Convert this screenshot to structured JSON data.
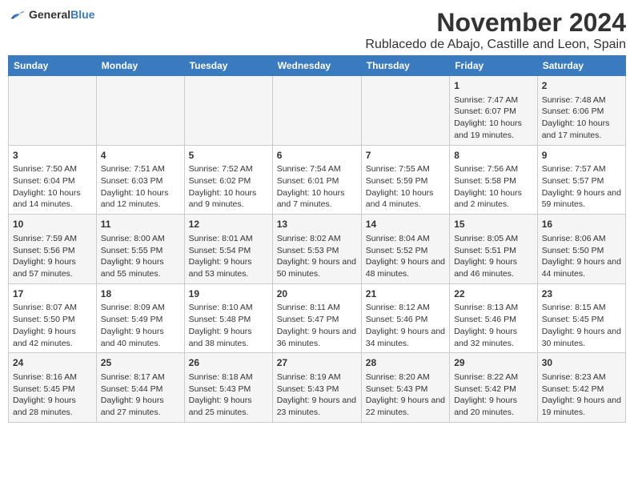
{
  "logo": {
    "general": "General",
    "blue": "Blue"
  },
  "title": "November 2024",
  "subtitle": "Rublacedo de Abajo, Castille and Leon, Spain",
  "days_header": [
    "Sunday",
    "Monday",
    "Tuesday",
    "Wednesday",
    "Thursday",
    "Friday",
    "Saturday"
  ],
  "weeks": [
    [
      {
        "day": "",
        "info": ""
      },
      {
        "day": "",
        "info": ""
      },
      {
        "day": "",
        "info": ""
      },
      {
        "day": "",
        "info": ""
      },
      {
        "day": "",
        "info": ""
      },
      {
        "day": "1",
        "info": "Sunrise: 7:47 AM\nSunset: 6:07 PM\nDaylight: 10 hours and 19 minutes."
      },
      {
        "day": "2",
        "info": "Sunrise: 7:48 AM\nSunset: 6:06 PM\nDaylight: 10 hours and 17 minutes."
      }
    ],
    [
      {
        "day": "3",
        "info": "Sunrise: 7:50 AM\nSunset: 6:04 PM\nDaylight: 10 hours and 14 minutes."
      },
      {
        "day": "4",
        "info": "Sunrise: 7:51 AM\nSunset: 6:03 PM\nDaylight: 10 hours and 12 minutes."
      },
      {
        "day": "5",
        "info": "Sunrise: 7:52 AM\nSunset: 6:02 PM\nDaylight: 10 hours and 9 minutes."
      },
      {
        "day": "6",
        "info": "Sunrise: 7:54 AM\nSunset: 6:01 PM\nDaylight: 10 hours and 7 minutes."
      },
      {
        "day": "7",
        "info": "Sunrise: 7:55 AM\nSunset: 5:59 PM\nDaylight: 10 hours and 4 minutes."
      },
      {
        "day": "8",
        "info": "Sunrise: 7:56 AM\nSunset: 5:58 PM\nDaylight: 10 hours and 2 minutes."
      },
      {
        "day": "9",
        "info": "Sunrise: 7:57 AM\nSunset: 5:57 PM\nDaylight: 9 hours and 59 minutes."
      }
    ],
    [
      {
        "day": "10",
        "info": "Sunrise: 7:59 AM\nSunset: 5:56 PM\nDaylight: 9 hours and 57 minutes."
      },
      {
        "day": "11",
        "info": "Sunrise: 8:00 AM\nSunset: 5:55 PM\nDaylight: 9 hours and 55 minutes."
      },
      {
        "day": "12",
        "info": "Sunrise: 8:01 AM\nSunset: 5:54 PM\nDaylight: 9 hours and 53 minutes."
      },
      {
        "day": "13",
        "info": "Sunrise: 8:02 AM\nSunset: 5:53 PM\nDaylight: 9 hours and 50 minutes."
      },
      {
        "day": "14",
        "info": "Sunrise: 8:04 AM\nSunset: 5:52 PM\nDaylight: 9 hours and 48 minutes."
      },
      {
        "day": "15",
        "info": "Sunrise: 8:05 AM\nSunset: 5:51 PM\nDaylight: 9 hours and 46 minutes."
      },
      {
        "day": "16",
        "info": "Sunrise: 8:06 AM\nSunset: 5:50 PM\nDaylight: 9 hours and 44 minutes."
      }
    ],
    [
      {
        "day": "17",
        "info": "Sunrise: 8:07 AM\nSunset: 5:50 PM\nDaylight: 9 hours and 42 minutes."
      },
      {
        "day": "18",
        "info": "Sunrise: 8:09 AM\nSunset: 5:49 PM\nDaylight: 9 hours and 40 minutes."
      },
      {
        "day": "19",
        "info": "Sunrise: 8:10 AM\nSunset: 5:48 PM\nDaylight: 9 hours and 38 minutes."
      },
      {
        "day": "20",
        "info": "Sunrise: 8:11 AM\nSunset: 5:47 PM\nDaylight: 9 hours and 36 minutes."
      },
      {
        "day": "21",
        "info": "Sunrise: 8:12 AM\nSunset: 5:46 PM\nDaylight: 9 hours and 34 minutes."
      },
      {
        "day": "22",
        "info": "Sunrise: 8:13 AM\nSunset: 5:46 PM\nDaylight: 9 hours and 32 minutes."
      },
      {
        "day": "23",
        "info": "Sunrise: 8:15 AM\nSunset: 5:45 PM\nDaylight: 9 hours and 30 minutes."
      }
    ],
    [
      {
        "day": "24",
        "info": "Sunrise: 8:16 AM\nSunset: 5:45 PM\nDaylight: 9 hours and 28 minutes."
      },
      {
        "day": "25",
        "info": "Sunrise: 8:17 AM\nSunset: 5:44 PM\nDaylight: 9 hours and 27 minutes."
      },
      {
        "day": "26",
        "info": "Sunrise: 8:18 AM\nSunset: 5:43 PM\nDaylight: 9 hours and 25 minutes."
      },
      {
        "day": "27",
        "info": "Sunrise: 8:19 AM\nSunset: 5:43 PM\nDaylight: 9 hours and 23 minutes."
      },
      {
        "day": "28",
        "info": "Sunrise: 8:20 AM\nSunset: 5:43 PM\nDaylight: 9 hours and 22 minutes."
      },
      {
        "day": "29",
        "info": "Sunrise: 8:22 AM\nSunset: 5:42 PM\nDaylight: 9 hours and 20 minutes."
      },
      {
        "day": "30",
        "info": "Sunrise: 8:23 AM\nSunset: 5:42 PM\nDaylight: 9 hours and 19 minutes."
      }
    ]
  ]
}
